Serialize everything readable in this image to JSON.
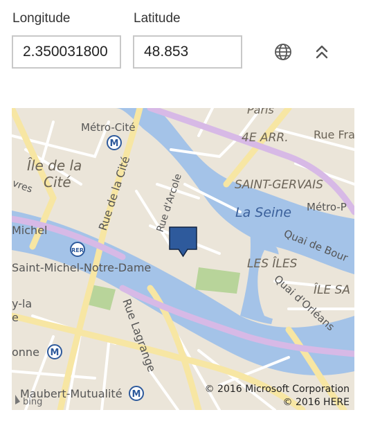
{
  "form": {
    "longitude": {
      "label": "Longitude",
      "value": "2.350031800"
    },
    "latitude": {
      "label": "Latitude",
      "value": "48.853"
    }
  },
  "toolbar": {
    "globe_icon": "globe-icon",
    "collapse_icon": "chevron-double-up-icon"
  },
  "map": {
    "labels": {
      "paris": "Paris",
      "arr4": "4E ARR.",
      "rue_fra": "Rue Fra",
      "metro_cite": "Métro-Cité",
      "ile_de_la": "Île de la",
      "cite": "Cité",
      "rue_de_la_cite": "Rue de la Cité",
      "rue_darcole": "Rue d'Arcole",
      "saint_gervais": "SAINT-GERVAIS",
      "la_seine": "La Seine",
      "metro_p": "Métro-P",
      "vres": "vres",
      "michel": "Michel",
      "quai_de_bourbon": "Quai de Bour",
      "les_iles": "LES ÎLES",
      "ile_sa": "ÎLE SA",
      "saint_michel_nd": "Saint-Michel-Notre-Dame",
      "y_la": "y-la",
      "e": "e",
      "rue_lagrange": "Rue Lagrange",
      "quai_dorleans": "Quai d'Orléans",
      "onne": "onne",
      "maubert": "Maubert-Mutualité",
      "bing": "bing",
      "credit_ms": "© 2016 Microsoft Corporation",
      "credit_here": "© 2016 HERE"
    },
    "colors": {
      "water": "#a4c3e8",
      "land": "#ebe5d9",
      "major_road": "#f7e6a3",
      "purple_road": "#d7b9e6",
      "park": "#b8d49a",
      "pin": "#2e5a9c"
    }
  }
}
